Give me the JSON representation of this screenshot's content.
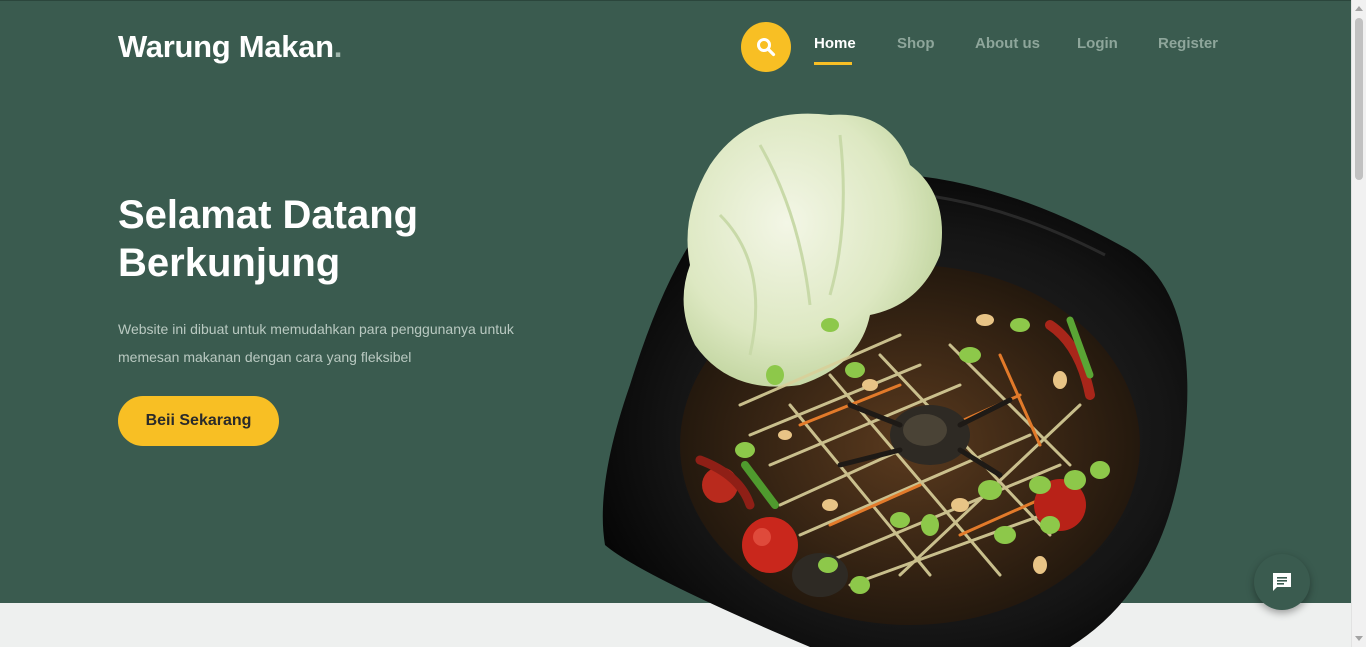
{
  "header": {
    "brand": "Warung Makan",
    "brand_dot": ".",
    "nav": [
      {
        "label": "Home",
        "active": true
      },
      {
        "label": "Shop",
        "active": false
      },
      {
        "label": "About us",
        "active": false
      },
      {
        "label": "Login",
        "active": false
      },
      {
        "label": "Register",
        "active": false
      }
    ]
  },
  "hero": {
    "title_line1": "Selamat Datang",
    "title_line2": "Berkunjung",
    "description": "Website ini dibuat untuk memudahkan para penggunanya untuk memesan makanan dengan cara yang fleksibel",
    "cta_label": "Beii Sekarang"
  },
  "icons": {
    "search": "search-icon",
    "chat": "chat-icon"
  },
  "colors": {
    "hero_bg": "#3a5b4f",
    "accent": "#f8bf24",
    "below_bg": "#eef0ef"
  }
}
